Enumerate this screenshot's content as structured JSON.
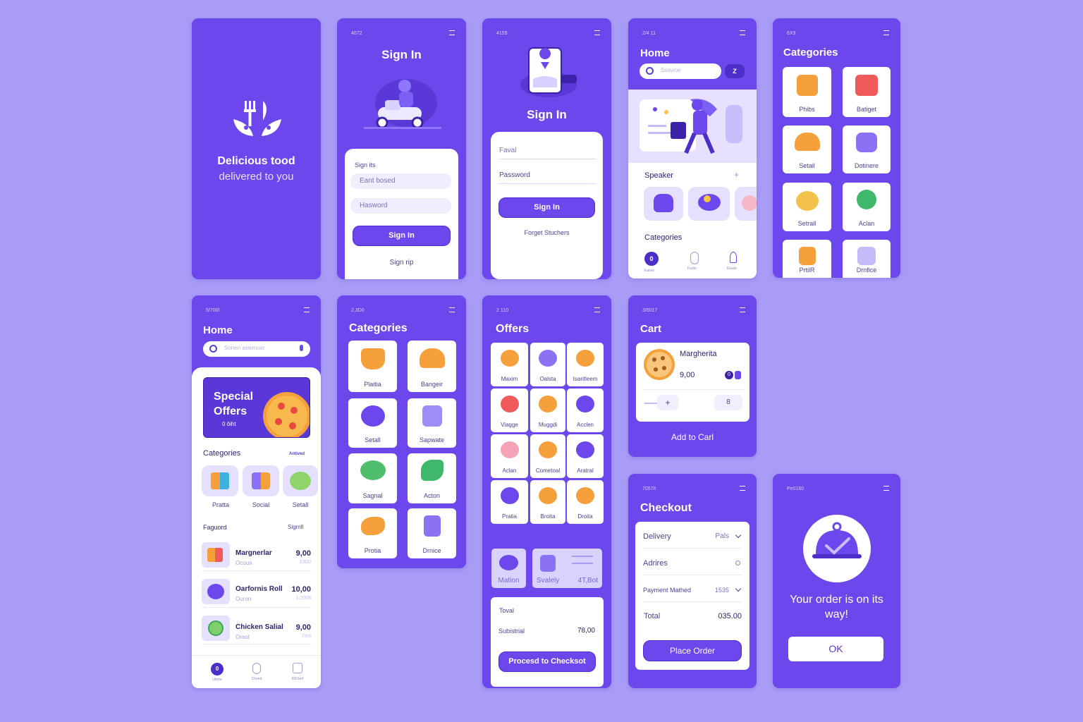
{
  "colors": {
    "background": "#a89cf7",
    "primary": "#6b47ec",
    "surface": "#ffffff",
    "accent_orange": "#f6a03b"
  },
  "splash": {
    "headline": "Delicious tood",
    "subline": "delivered to you",
    "logo_icon": "fork-leaf-logo-icon"
  },
  "signin1": {
    "status": "4072",
    "title": "Sign In",
    "section_label": "Sign its",
    "email_placeholder": "Eant bosed",
    "password_placeholder": "Hasword",
    "button": "Sign In",
    "secondary_link": "Sign rip",
    "illustration": "scooter-courier-illustration"
  },
  "signin2": {
    "status": "4159",
    "title": "Sign In",
    "email_label": "Faval",
    "password_label": "Password",
    "button": "Sign In",
    "forgot_link": "Forget Stuchers",
    "illustration": "phone-location-illustration"
  },
  "home1": {
    "status": "2/4 11",
    "title": "Home",
    "search_placeholder": "Ssawoe",
    "filter_label": "Z",
    "banner_illustration": "delivery-person-illustration",
    "speaker_label": "Speaker",
    "plus": "+",
    "categories_label": "Categories",
    "nav": [
      {
        "label": "Eaiser",
        "badge": "0"
      },
      {
        "label": "Furtis"
      },
      {
        "label": "Elusto"
      }
    ]
  },
  "cat1": {
    "status": "6X9",
    "title": "Categories",
    "items": [
      "Phibs",
      "Batiget",
      "Setail",
      "Dotinere",
      "Setrall",
      "Aclan",
      "PrtilR",
      "Drnfice"
    ]
  },
  "home2": {
    "status": "5/700l",
    "title": "Home",
    "search_placeholder": "Sonen aswmuer",
    "banner_title_1": "Special",
    "banner_title_2": "Offers",
    "banner_sub": "0 ôiht",
    "categories_label": "Categories",
    "categories_link": "Antived",
    "categories": [
      "Pratta",
      "Social",
      "Setall"
    ],
    "featured_label": "Faguord",
    "featured_link": "Sigrnll",
    "items": [
      {
        "name": "Margnerlar",
        "sub": "Ocoun",
        "price": "9,00",
        "price_sub": "£800"
      },
      {
        "name": "Oarfornis Roll",
        "sub": "Ouron",
        "price": "10,00",
        "price_sub": "1:2008"
      },
      {
        "name": "Chicken Salial",
        "sub": "Oraot",
        "price": "9,00",
        "price_sub": "7ìirtl"
      }
    ],
    "nav": [
      {
        "label": "Ltkme",
        "badge": "0"
      },
      {
        "label": "Chond"
      },
      {
        "label": "60Ctorf"
      }
    ]
  },
  "cat2": {
    "status": "2,3D0",
    "title": "Categories",
    "items": [
      "Plaitia",
      "Bangeir",
      "Setall",
      "Sapwate",
      "Sagnal",
      "Acton",
      "Protia",
      "Drnice"
    ]
  },
  "offers": {
    "status": "2 110",
    "title": "Offers",
    "grid": [
      "Maxim",
      "Oalsta",
      "Isaritleem",
      "Viagge",
      "Muggdi",
      "Acclen",
      "Aclan",
      "Cometoal",
      "Aratral",
      "Pratia",
      "Broita",
      "Droita"
    ],
    "promo": [
      "Mation",
      "Svalely",
      "4T,Bot"
    ],
    "total_label": "Toval",
    "subtotal_label": "Subistrial",
    "subtotal_value": "78,00",
    "button": "Procesd to Checksot"
  },
  "cart": {
    "status": "3/6017",
    "title": "Cart",
    "item_name": "Margherita",
    "item_price": "9,00",
    "qty_badge": "0",
    "plus": "+",
    "qty": "8",
    "add_button": "Add to Carl"
  },
  "checkout": {
    "status": "7057h",
    "title": "Checkout",
    "rows": [
      {
        "label": "Delivery",
        "value": "Pals"
      },
      {
        "label": "Adrires",
        "value": ""
      },
      {
        "label": "Payment Mathed",
        "value": "1535"
      }
    ],
    "total_label": "Total",
    "total_value": "035.00",
    "button": "Place Order"
  },
  "confirm": {
    "status": "Pe0160",
    "message": "Your order is on its way!",
    "button": "OK",
    "icon": "cloche-check-icon"
  }
}
